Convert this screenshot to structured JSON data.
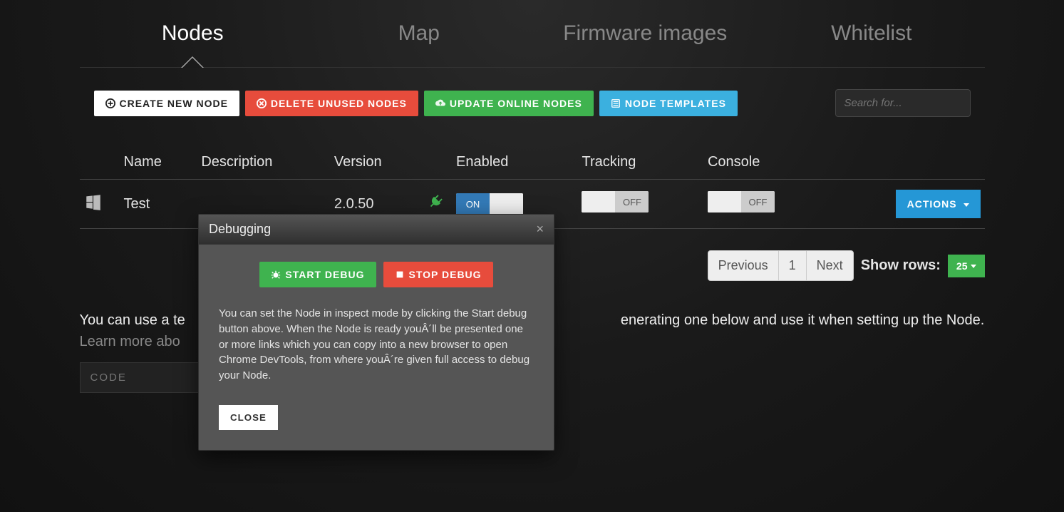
{
  "tabs": {
    "nodes": "Nodes",
    "map": "Map",
    "firmware": "Firmware images",
    "whitelist": "Whitelist"
  },
  "toolbar": {
    "create": "CREATE NEW NODE",
    "delete": "DELETE UNUSED NODES",
    "update": "UPDATE ONLINE NODES",
    "templates": "NODE TEMPLATES",
    "search_placeholder": "Search for..."
  },
  "table": {
    "headers": {
      "name": "Name",
      "description": "Description",
      "version": "Version",
      "enabled": "Enabled",
      "tracking": "Tracking",
      "console": "Console"
    },
    "row": {
      "name": "Test",
      "description": "",
      "version": "2.0.50",
      "enabled_on": "ON",
      "tracking_off": "OFF",
      "console_off": "OFF",
      "actions": "ACTIONS"
    }
  },
  "pagination": {
    "previous": "Previous",
    "page": "1",
    "next": "Next",
    "show_rows": "Show rows:",
    "rows": "25"
  },
  "help": {
    "line1_pre": "You can use a te",
    "line1_post": "enerating one below and use it when setting up the Node.",
    "line2": "Learn more abo",
    "code_placeholder": "CODE"
  },
  "modal": {
    "title": "Debugging",
    "start": "START DEBUG",
    "stop": "STOP DEBUG",
    "text": "You can set the Node in inspect mode by clicking the Start debug button above. When the Node is ready youÂ´ll be presented one or more links which you can copy into a new browser to open Chrome DevTools, from where youÂ´re given full access to debug your Node.",
    "close": "CLOSE"
  }
}
